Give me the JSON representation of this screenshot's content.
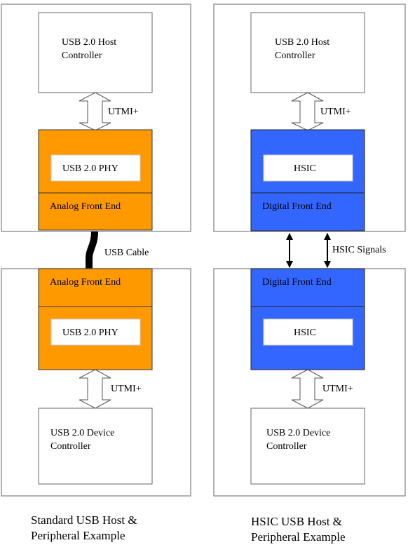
{
  "colors": {
    "phy_block": "#FF9900",
    "hsic_block": "#3366FF"
  },
  "left": {
    "host_controller": [
      "USB 2.0 Host",
      "Controller"
    ],
    "host_interface": "UTMI+",
    "host_phy": "USB 2.0 PHY",
    "host_front_end": "Analog Front End",
    "link": "USB Cable",
    "device_front_end": "Analog Front End",
    "device_phy": "USB 2.0 PHY",
    "device_interface": "UTMI+",
    "device_controller": [
      "USB 2.0 Device",
      "Controller"
    ],
    "caption": [
      "Standard USB Host &",
      "Peripheral Example"
    ]
  },
  "right": {
    "host_controller": [
      "USB 2.0 Host",
      "Controller"
    ],
    "host_interface": "UTMI+",
    "host_phy": "HSIC",
    "host_front_end": "Digital Front End",
    "link": "HSIC Signals",
    "device_front_end": "Digital Front End",
    "device_phy": "HSIC",
    "device_interface": "UTMI+",
    "device_controller": [
      "USB 2.0 Device",
      "Controller"
    ],
    "caption": [
      "HSIC USB Host &",
      "Peripheral Example"
    ]
  }
}
